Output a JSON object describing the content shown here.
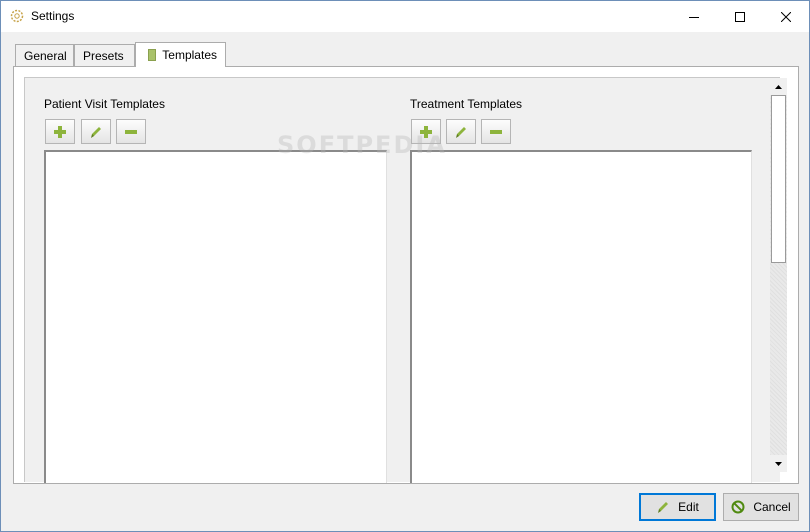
{
  "window": {
    "title": "Settings",
    "icon": "settings-gear-icon"
  },
  "tabs": [
    {
      "label": "General",
      "active": false
    },
    {
      "label": "Presets",
      "active": false
    },
    {
      "label": "Templates",
      "active": true,
      "icon": "template-icon"
    }
  ],
  "templates": {
    "patient_visit": {
      "label": "Patient Visit Templates",
      "tools": [
        "add-icon",
        "edit-pencil-icon",
        "remove-icon"
      ],
      "items": []
    },
    "treatment": {
      "label": "Treatment Templates",
      "tools": [
        "add-icon",
        "edit-pencil-icon",
        "remove-icon"
      ],
      "items": []
    }
  },
  "footer": {
    "edit_label": "Edit",
    "cancel_label": "Cancel"
  },
  "watermark": "SOFTPEDIA",
  "colors": {
    "accent_green": "#8db43c",
    "focus_blue": "#0078d7",
    "cancel_green": "#4f8a10"
  }
}
